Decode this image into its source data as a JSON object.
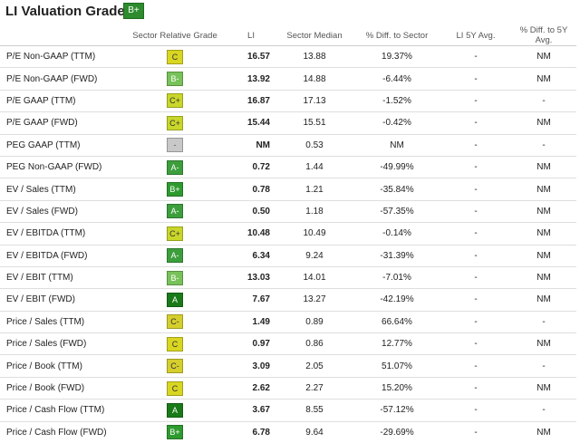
{
  "title": "LI Valuation Grade",
  "overall_grade": "B+",
  "columns": [
    "Sector Relative Grade",
    "LI",
    "Sector Median",
    "% Diff. to Sector",
    "LI 5Y Avg.",
    "% Diff. to 5Y Avg."
  ],
  "grade_colors": {
    "A": "#1a7a1a",
    "A-": "#3c9e3c",
    "B+": "#2f9a2f",
    "B": "#6abf49",
    "B-": "#78c25a",
    "C+": "#c9d62a",
    "C": "#d9d622",
    "C-": "#d5cf2d",
    "-": "#c8c8c8"
  },
  "grade_text_colors": {
    "A": "#ffffff",
    "A-": "#ffffff",
    "B+": "#ffffff",
    "B": "#ffffff",
    "B-": "#ffffff",
    "C+": "#333333",
    "C": "#333333",
    "C-": "#333333",
    "-": "#555555"
  },
  "rows": [
    {
      "metric": "P/E Non-GAAP (TTM)",
      "grade": "C",
      "li": "16.57",
      "median": "13.88",
      "diff": "19.37%",
      "avg5": "-",
      "diff5": "NM"
    },
    {
      "metric": "P/E Non-GAAP (FWD)",
      "grade": "B-",
      "li": "13.92",
      "median": "14.88",
      "diff": "-6.44%",
      "avg5": "-",
      "diff5": "NM"
    },
    {
      "metric": "P/E GAAP (TTM)",
      "grade": "C+",
      "li": "16.87",
      "median": "17.13",
      "diff": "-1.52%",
      "avg5": "-",
      "diff5": "-"
    },
    {
      "metric": "P/E GAAP (FWD)",
      "grade": "C+",
      "li": "15.44",
      "median": "15.51",
      "diff": "-0.42%",
      "avg5": "-",
      "diff5": "NM"
    },
    {
      "metric": "PEG GAAP (TTM)",
      "grade": "-",
      "li": "NM",
      "median": "0.53",
      "diff": "NM",
      "avg5": "-",
      "diff5": "-"
    },
    {
      "metric": "PEG Non-GAAP (FWD)",
      "grade": "A-",
      "li": "0.72",
      "median": "1.44",
      "diff": "-49.99%",
      "avg5": "-",
      "diff5": "NM"
    },
    {
      "metric": "EV / Sales (TTM)",
      "grade": "B+",
      "li": "0.78",
      "median": "1.21",
      "diff": "-35.84%",
      "avg5": "-",
      "diff5": "NM"
    },
    {
      "metric": "EV / Sales (FWD)",
      "grade": "A-",
      "li": "0.50",
      "median": "1.18",
      "diff": "-57.35%",
      "avg5": "-",
      "diff5": "NM"
    },
    {
      "metric": "EV / EBITDA (TTM)",
      "grade": "C+",
      "li": "10.48",
      "median": "10.49",
      "diff": "-0.14%",
      "avg5": "-",
      "diff5": "NM"
    },
    {
      "metric": "EV / EBITDA (FWD)",
      "grade": "A-",
      "li": "6.34",
      "median": "9.24",
      "diff": "-31.39%",
      "avg5": "-",
      "diff5": "NM"
    },
    {
      "metric": "EV / EBIT (TTM)",
      "grade": "B-",
      "li": "13.03",
      "median": "14.01",
      "diff": "-7.01%",
      "avg5": "-",
      "diff5": "NM"
    },
    {
      "metric": "EV / EBIT (FWD)",
      "grade": "A",
      "li": "7.67",
      "median": "13.27",
      "diff": "-42.19%",
      "avg5": "-",
      "diff5": "NM"
    },
    {
      "metric": "Price / Sales (TTM)",
      "grade": "C-",
      "li": "1.49",
      "median": "0.89",
      "diff": "66.64%",
      "avg5": "-",
      "diff5": "-"
    },
    {
      "metric": "Price / Sales (FWD)",
      "grade": "C",
      "li": "0.97",
      "median": "0.86",
      "diff": "12.77%",
      "avg5": "-",
      "diff5": "NM"
    },
    {
      "metric": "Price / Book (TTM)",
      "grade": "C-",
      "li": "3.09",
      "median": "2.05",
      "diff": "51.07%",
      "avg5": "-",
      "diff5": "-"
    },
    {
      "metric": "Price / Book (FWD)",
      "grade": "C",
      "li": "2.62",
      "median": "2.27",
      "diff": "15.20%",
      "avg5": "-",
      "diff5": "NM"
    },
    {
      "metric": "Price / Cash Flow (TTM)",
      "grade": "A",
      "li": "3.67",
      "median": "8.55",
      "diff": "-57.12%",
      "avg5": "-",
      "diff5": "-"
    },
    {
      "metric": "Price / Cash Flow (FWD)",
      "grade": "B+",
      "li": "6.78",
      "median": "9.64",
      "diff": "-29.69%",
      "avg5": "-",
      "diff5": "NM"
    }
  ]
}
